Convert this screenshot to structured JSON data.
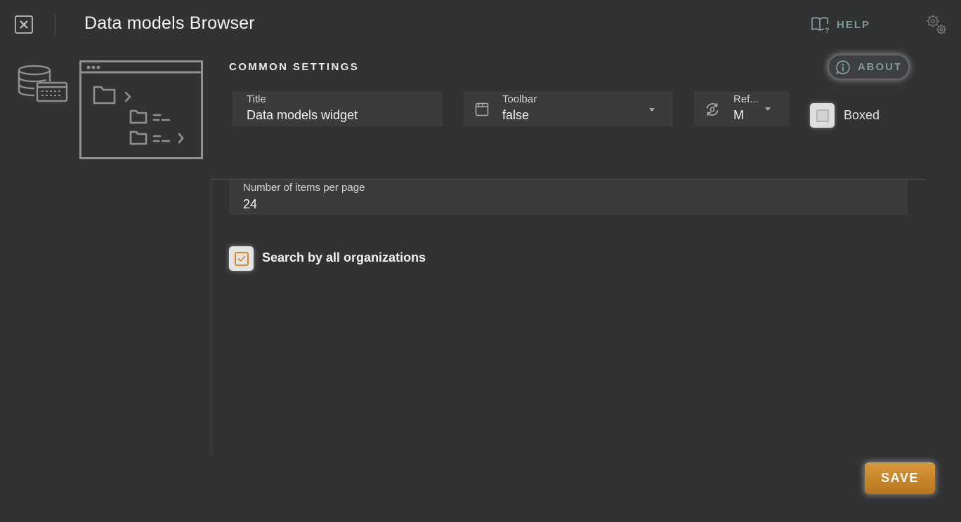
{
  "header": {
    "title": "Data models Browser",
    "help_label": "HELP",
    "close_icon": "close-icon",
    "settings_icon": "gears-icon"
  },
  "common_settings": {
    "section_title": "COMMON SETTINGS",
    "about_label": "ABOUT",
    "title_field": {
      "label": "Title",
      "value": "Data models widget"
    },
    "toolbar_field": {
      "label": "Toolbar",
      "value": "false"
    },
    "refresh_field": {
      "label": "Ref...",
      "value": "M"
    },
    "boxed": {
      "label": "Boxed",
      "checked": false
    }
  },
  "widget_settings": {
    "items_per_page": {
      "label": "Number of items per page",
      "value": "24"
    },
    "search_all_orgs": {
      "label": "Search by all organizations",
      "checked": true
    }
  },
  "actions": {
    "save_label": "SAVE"
  },
  "colors": {
    "background": "#313234",
    "field_bg": "#3a3b3d",
    "accent_teal": "#7e9b9c",
    "accent_orange": "#d08a28",
    "save_button": "#c9892f"
  }
}
